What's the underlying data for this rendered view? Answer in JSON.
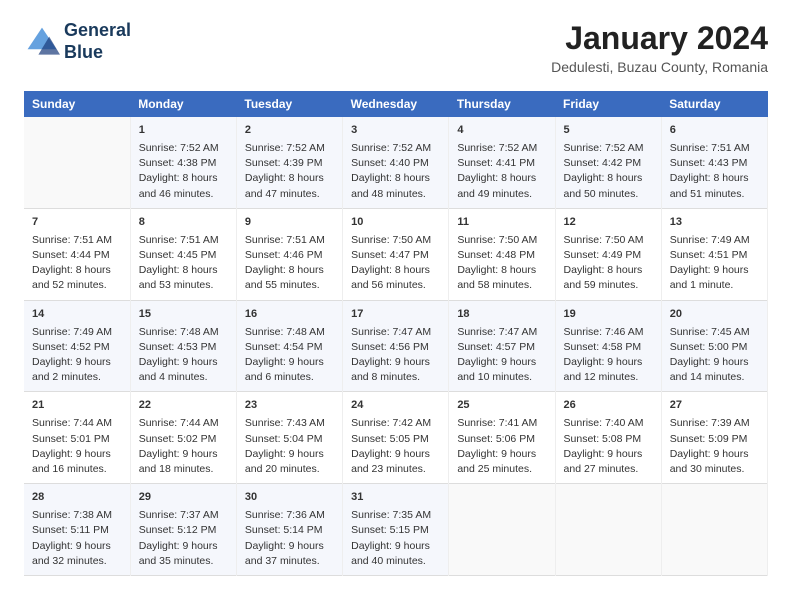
{
  "header": {
    "logo_line1": "General",
    "logo_line2": "Blue",
    "month": "January 2024",
    "location": "Dedulesti, Buzau County, Romania"
  },
  "weekdays": [
    "Sunday",
    "Monday",
    "Tuesday",
    "Wednesday",
    "Thursday",
    "Friday",
    "Saturday"
  ],
  "weeks": [
    [
      {
        "day": "",
        "info": ""
      },
      {
        "day": "1",
        "info": "Sunrise: 7:52 AM\nSunset: 4:38 PM\nDaylight: 8 hours\nand 46 minutes."
      },
      {
        "day": "2",
        "info": "Sunrise: 7:52 AM\nSunset: 4:39 PM\nDaylight: 8 hours\nand 47 minutes."
      },
      {
        "day": "3",
        "info": "Sunrise: 7:52 AM\nSunset: 4:40 PM\nDaylight: 8 hours\nand 48 minutes."
      },
      {
        "day": "4",
        "info": "Sunrise: 7:52 AM\nSunset: 4:41 PM\nDaylight: 8 hours\nand 49 minutes."
      },
      {
        "day": "5",
        "info": "Sunrise: 7:52 AM\nSunset: 4:42 PM\nDaylight: 8 hours\nand 50 minutes."
      },
      {
        "day": "6",
        "info": "Sunrise: 7:51 AM\nSunset: 4:43 PM\nDaylight: 8 hours\nand 51 minutes."
      }
    ],
    [
      {
        "day": "7",
        "info": "Sunrise: 7:51 AM\nSunset: 4:44 PM\nDaylight: 8 hours\nand 52 minutes."
      },
      {
        "day": "8",
        "info": "Sunrise: 7:51 AM\nSunset: 4:45 PM\nDaylight: 8 hours\nand 53 minutes."
      },
      {
        "day": "9",
        "info": "Sunrise: 7:51 AM\nSunset: 4:46 PM\nDaylight: 8 hours\nand 55 minutes."
      },
      {
        "day": "10",
        "info": "Sunrise: 7:50 AM\nSunset: 4:47 PM\nDaylight: 8 hours\nand 56 minutes."
      },
      {
        "day": "11",
        "info": "Sunrise: 7:50 AM\nSunset: 4:48 PM\nDaylight: 8 hours\nand 58 minutes."
      },
      {
        "day": "12",
        "info": "Sunrise: 7:50 AM\nSunset: 4:49 PM\nDaylight: 8 hours\nand 59 minutes."
      },
      {
        "day": "13",
        "info": "Sunrise: 7:49 AM\nSunset: 4:51 PM\nDaylight: 9 hours\nand 1 minute."
      }
    ],
    [
      {
        "day": "14",
        "info": "Sunrise: 7:49 AM\nSunset: 4:52 PM\nDaylight: 9 hours\nand 2 minutes."
      },
      {
        "day": "15",
        "info": "Sunrise: 7:48 AM\nSunset: 4:53 PM\nDaylight: 9 hours\nand 4 minutes."
      },
      {
        "day": "16",
        "info": "Sunrise: 7:48 AM\nSunset: 4:54 PM\nDaylight: 9 hours\nand 6 minutes."
      },
      {
        "day": "17",
        "info": "Sunrise: 7:47 AM\nSunset: 4:56 PM\nDaylight: 9 hours\nand 8 minutes."
      },
      {
        "day": "18",
        "info": "Sunrise: 7:47 AM\nSunset: 4:57 PM\nDaylight: 9 hours\nand 10 minutes."
      },
      {
        "day": "19",
        "info": "Sunrise: 7:46 AM\nSunset: 4:58 PM\nDaylight: 9 hours\nand 12 minutes."
      },
      {
        "day": "20",
        "info": "Sunrise: 7:45 AM\nSunset: 5:00 PM\nDaylight: 9 hours\nand 14 minutes."
      }
    ],
    [
      {
        "day": "21",
        "info": "Sunrise: 7:44 AM\nSunset: 5:01 PM\nDaylight: 9 hours\nand 16 minutes."
      },
      {
        "day": "22",
        "info": "Sunrise: 7:44 AM\nSunset: 5:02 PM\nDaylight: 9 hours\nand 18 minutes."
      },
      {
        "day": "23",
        "info": "Sunrise: 7:43 AM\nSunset: 5:04 PM\nDaylight: 9 hours\nand 20 minutes."
      },
      {
        "day": "24",
        "info": "Sunrise: 7:42 AM\nSunset: 5:05 PM\nDaylight: 9 hours\nand 23 minutes."
      },
      {
        "day": "25",
        "info": "Sunrise: 7:41 AM\nSunset: 5:06 PM\nDaylight: 9 hours\nand 25 minutes."
      },
      {
        "day": "26",
        "info": "Sunrise: 7:40 AM\nSunset: 5:08 PM\nDaylight: 9 hours\nand 27 minutes."
      },
      {
        "day": "27",
        "info": "Sunrise: 7:39 AM\nSunset: 5:09 PM\nDaylight: 9 hours\nand 30 minutes."
      }
    ],
    [
      {
        "day": "28",
        "info": "Sunrise: 7:38 AM\nSunset: 5:11 PM\nDaylight: 9 hours\nand 32 minutes."
      },
      {
        "day": "29",
        "info": "Sunrise: 7:37 AM\nSunset: 5:12 PM\nDaylight: 9 hours\nand 35 minutes."
      },
      {
        "day": "30",
        "info": "Sunrise: 7:36 AM\nSunset: 5:14 PM\nDaylight: 9 hours\nand 37 minutes."
      },
      {
        "day": "31",
        "info": "Sunrise: 7:35 AM\nSunset: 5:15 PM\nDaylight: 9 hours\nand 40 minutes."
      },
      {
        "day": "",
        "info": ""
      },
      {
        "day": "",
        "info": ""
      },
      {
        "day": "",
        "info": ""
      }
    ]
  ]
}
